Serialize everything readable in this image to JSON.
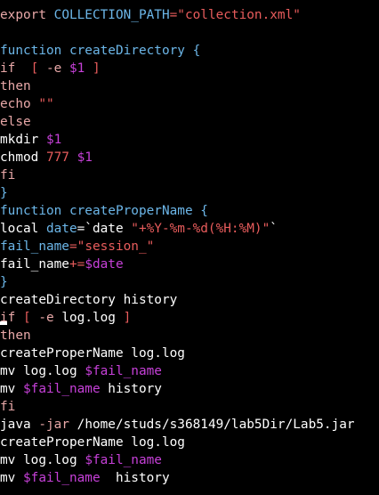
{
  "colors": {
    "background": "#000000",
    "default": "#ffffff",
    "keyword": "#e8a8a8",
    "func": "#6cb6e8",
    "string": "#e85c5c",
    "variable": "#c640d8",
    "operator": "#e85c5c"
  },
  "editor": {
    "lines": [
      [
        {
          "t": "export ",
          "c": "keyword"
        },
        {
          "t": "COLLECTION_PATH",
          "c": "func"
        },
        {
          "t": "=",
          "c": "operator"
        },
        {
          "t": "\"collection.xml\"",
          "c": "string"
        }
      ],
      [],
      [
        {
          "t": "function ",
          "c": "func"
        },
        {
          "t": "createDirectory {",
          "c": "func"
        }
      ],
      [
        {
          "t": "if  ",
          "c": "keyword"
        },
        {
          "t": "[ ",
          "c": "string"
        },
        {
          "t": "-e ",
          "c": "keyword"
        },
        {
          "t": "$1",
          "c": "variable"
        },
        {
          "t": " ]",
          "c": "string"
        }
      ],
      [
        {
          "t": "then",
          "c": "keyword"
        }
      ],
      [
        {
          "t": "echo ",
          "c": "keyword"
        },
        {
          "t": "\"\"",
          "c": "string"
        }
      ],
      [
        {
          "t": "else",
          "c": "keyword"
        }
      ],
      [
        {
          "t": "mkdir ",
          "c": "default"
        },
        {
          "t": "$1",
          "c": "variable"
        }
      ],
      [
        {
          "t": "chmod ",
          "c": "default"
        },
        {
          "t": "777 ",
          "c": "string"
        },
        {
          "t": "$1",
          "c": "variable"
        }
      ],
      [
        {
          "t": "fi",
          "c": "keyword"
        }
      ],
      [
        {
          "t": "}",
          "c": "func"
        }
      ],
      [
        {
          "t": "function ",
          "c": "func"
        },
        {
          "t": "createProperName {",
          "c": "func"
        }
      ],
      [
        {
          "t": "local ",
          "c": "default"
        },
        {
          "t": "date",
          "c": "func"
        },
        {
          "t": "=`date ",
          "c": "default"
        },
        {
          "t": "\"+%Y-%m-%d(%H:%M)\"",
          "c": "string"
        },
        {
          "t": "`",
          "c": "default"
        }
      ],
      [
        {
          "t": "fail_name",
          "c": "func"
        },
        {
          "t": "=",
          "c": "operator"
        },
        {
          "t": "\"session_\"",
          "c": "string"
        }
      ],
      [
        {
          "t": "fail_name",
          "c": "default"
        },
        {
          "t": "+=",
          "c": "operator"
        },
        {
          "t": "$date",
          "c": "variable"
        }
      ],
      [
        {
          "t": "}",
          "c": "func"
        }
      ],
      [
        {
          "t": "createDirectory history",
          "c": "default"
        }
      ],
      [
        {
          "t": "if ",
          "c": "keyword"
        },
        {
          "t": "[ ",
          "c": "string"
        },
        {
          "t": "-e ",
          "c": "keyword"
        },
        {
          "t": "log.log",
          "c": "default"
        },
        {
          "t": " ]",
          "c": "string"
        }
      ],
      [
        {
          "t": "then",
          "c": "keyword"
        }
      ],
      [
        {
          "t": "createProperName log.log",
          "c": "default"
        }
      ],
      [
        {
          "t": "mv log.log ",
          "c": "default"
        },
        {
          "t": "$fail_name",
          "c": "variable"
        }
      ],
      [
        {
          "t": "mv ",
          "c": "default"
        },
        {
          "t": "$fail_name",
          "c": "variable"
        },
        {
          "t": " history",
          "c": "default"
        }
      ],
      [
        {
          "t": "fi",
          "c": "keyword"
        }
      ],
      [
        {
          "t": "java ",
          "c": "default"
        },
        {
          "t": "-jar ",
          "c": "keyword"
        },
        {
          "t": "/home/studs/s368149/lab5Dir/Lab5.jar",
          "c": "default"
        }
      ],
      [
        {
          "t": "createProperName log.log",
          "c": "default"
        }
      ],
      [
        {
          "t": "mv log.log ",
          "c": "default"
        },
        {
          "t": "$fail_name",
          "c": "variable"
        }
      ],
      [
        {
          "t": "mv ",
          "c": "default"
        },
        {
          "t": "$fail_name",
          "c": "variable"
        },
        {
          "t": "  history",
          "c": "default"
        }
      ]
    ]
  }
}
